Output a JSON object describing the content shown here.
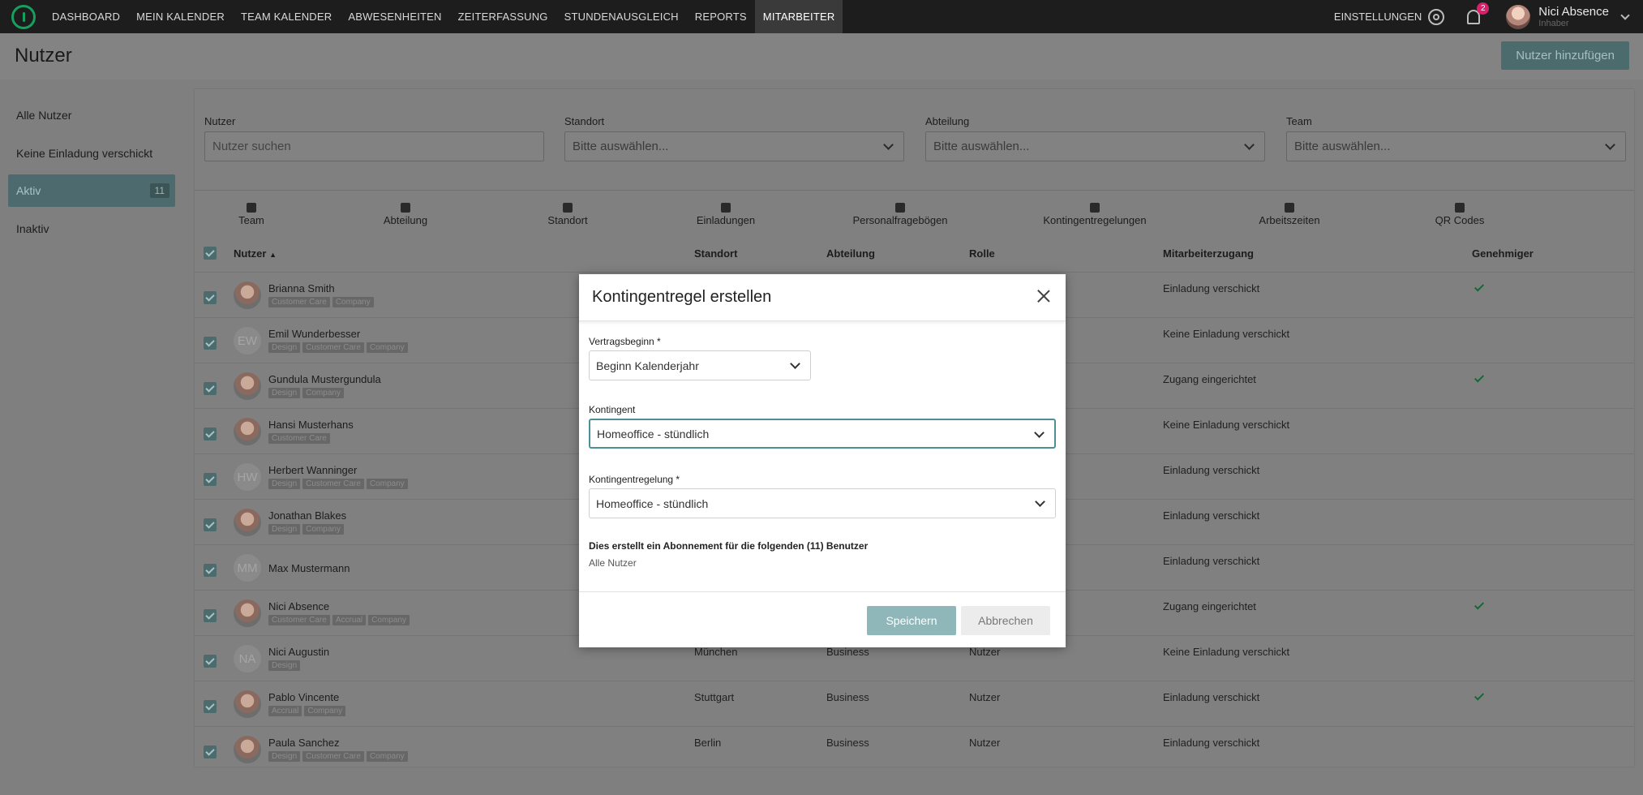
{
  "nav": {
    "items": [
      "DASHBOARD",
      "MEIN KALENDER",
      "TEAM KALENDER",
      "ABWESENHEITEN",
      "ZEITERFASSUNG",
      "STUNDENAUSGLEICH",
      "REPORTS",
      "MITARBEITER"
    ],
    "active_index": 7,
    "settings_label": "EINSTELLUNGEN",
    "notification_count": "2",
    "user_name": "Nici Absence",
    "user_role": "Inhaber"
  },
  "header": {
    "title": "Nutzer",
    "add_button": "Nutzer hinzufügen"
  },
  "sidebar": {
    "items": [
      {
        "label": "Alle Nutzer"
      },
      {
        "label": "Keine Einladung verschickt"
      },
      {
        "label": "Aktiv",
        "count": "11",
        "active": true
      },
      {
        "label": "Inaktiv"
      }
    ]
  },
  "filters": {
    "nutzer_label": "Nutzer",
    "nutzer_placeholder": "Nutzer suchen",
    "standort_label": "Standort",
    "standort_value": "Bitte auswählen...",
    "abteilung_label": "Abteilung",
    "abteilung_value": "Bitte auswählen...",
    "team_label": "Team",
    "team_value": "Bitte auswählen..."
  },
  "toolbar": [
    "Team",
    "Abteilung",
    "Standort",
    "Einladungen",
    "Personalfragebögen",
    "Kontingentregelungen",
    "Arbeitszeiten",
    "QR Codes"
  ],
  "table": {
    "headers": {
      "nutzer": "Nutzer",
      "standort": "Standort",
      "abteilung": "Abteilung",
      "rolle": "Rolle",
      "zugang": "Mitarbeiterzugang",
      "genehmiger": "Genehmiger"
    },
    "rows": [
      {
        "name": "Brianna Smith",
        "tags": [
          "Customer Care",
          "Company"
        ],
        "initials": "",
        "standort": "",
        "abteilung": "",
        "rolle": "",
        "zugang": "Einladung verschickt",
        "approver": true
      },
      {
        "name": "Emil Wunderbesser",
        "tags": [
          "Design",
          "Customer Care",
          "Company"
        ],
        "initials": "EW",
        "standort": "",
        "abteilung": "",
        "rolle": "",
        "zugang": "Keine Einladung verschickt",
        "approver": false
      },
      {
        "name": "Gundula Mustergundula",
        "tags": [
          "Design",
          "Company"
        ],
        "initials": "",
        "standort": "",
        "abteilung": "",
        "rolle": "",
        "zugang": "Zugang eingerichtet",
        "approver": true
      },
      {
        "name": "Hansi Musterhans",
        "tags": [
          "Customer Care"
        ],
        "initials": "",
        "standort": "",
        "abteilung": "",
        "rolle": "",
        "zugang": "Keine Einladung verschickt",
        "approver": false
      },
      {
        "name": "Herbert Wanninger",
        "tags": [
          "Design",
          "Customer Care",
          "Company"
        ],
        "initials": "HW",
        "standort": "",
        "abteilung": "",
        "rolle": "",
        "zugang": "Einladung verschickt",
        "approver": false
      },
      {
        "name": "Jonathan Blakes",
        "tags": [
          "Design",
          "Company"
        ],
        "initials": "",
        "standort": "",
        "abteilung": "",
        "rolle": "",
        "zugang": "Einladung verschickt",
        "approver": false
      },
      {
        "name": "Max Mustermann",
        "tags": [],
        "initials": "MM",
        "standort": "",
        "abteilung": "",
        "rolle": "",
        "zugang": "Einladung verschickt",
        "approver": false
      },
      {
        "name": "Nici Absence",
        "tags": [
          "Customer Care",
          "Accrual",
          "Company"
        ],
        "initials": "",
        "standort": "",
        "abteilung": "",
        "rolle": "",
        "zugang": "Zugang eingerichtet",
        "approver": true
      },
      {
        "name": "Nici Augustin",
        "tags": [
          "Design"
        ],
        "initials": "NA",
        "standort": "München",
        "abteilung": "Business",
        "rolle": "Nutzer",
        "zugang": "Keine Einladung verschickt",
        "approver": false
      },
      {
        "name": "Pablo Vincente",
        "tags": [
          "Accrual",
          "Company"
        ],
        "initials": "",
        "standort": "Stuttgart",
        "abteilung": "Business",
        "rolle": "Nutzer",
        "zugang": "Einladung verschickt",
        "approver": true
      },
      {
        "name": "Paula Sanchez",
        "tags": [
          "Design",
          "Customer Care",
          "Company"
        ],
        "initials": "",
        "standort": "Berlin",
        "abteilung": "Business",
        "rolle": "Nutzer",
        "zugang": "Einladung verschickt",
        "approver": false
      }
    ]
  },
  "modal": {
    "title": "Kontingentregel erstellen",
    "vertragsbeginn_label": "Vertragsbeginn *",
    "vertragsbeginn_value": "Beginn Kalenderjahr",
    "kontingent_label": "Kontingent",
    "kontingent_value": "Homeoffice - stündlich",
    "regelung_label": "Kontingentregelung *",
    "regelung_value": "Homeoffice - stündlich",
    "info": "Dies erstellt ein Abonnement für die folgenden (11) Benutzer",
    "info_sub": "Alle Nutzer",
    "save": "Speichern",
    "cancel": "Abbrechen"
  }
}
